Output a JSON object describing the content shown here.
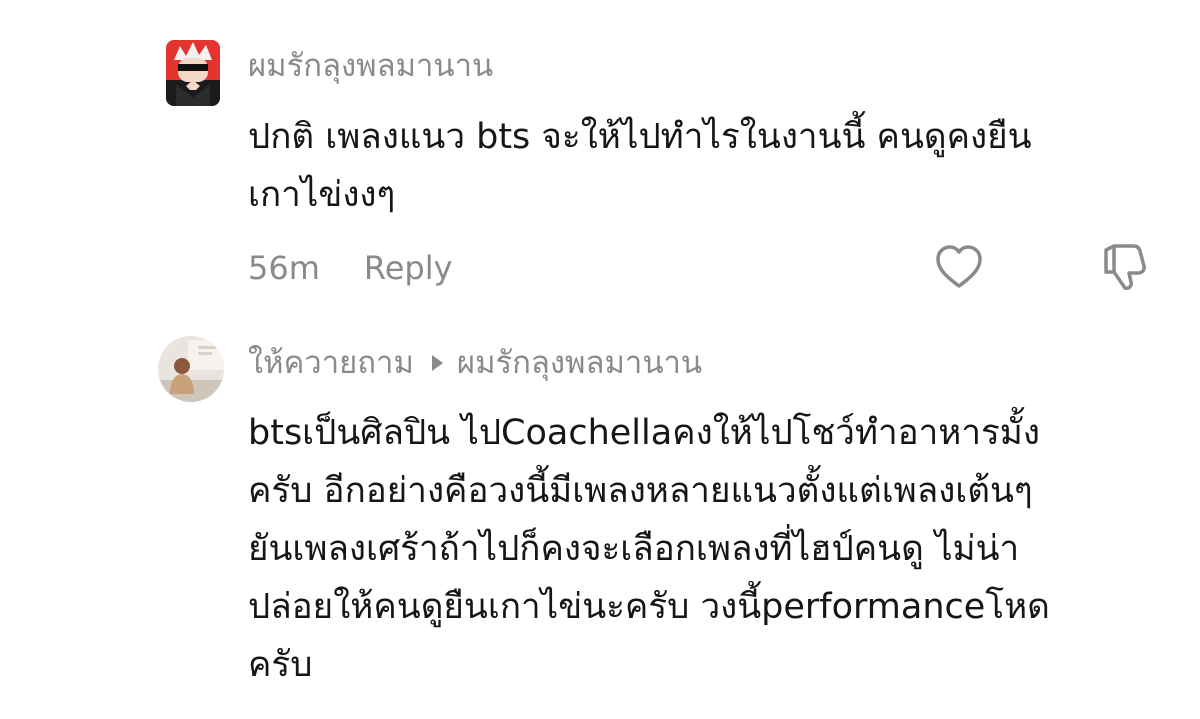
{
  "comments": [
    {
      "username": "ผมรักลุงพลมานาน",
      "avatar_icon": "anime-character-avatar",
      "lines": [
        "ปกติ เพลงแนว bts จะให้ไปทำไรในงานนี้ คนดูคงยืน",
        "เกาไข่งงๆ"
      ],
      "time": "56m",
      "reply_label": "Reply",
      "like_icon": "heart-outline-icon",
      "dislike_icon": "thumbs-down-outline-icon"
    },
    {
      "username": "ให้ควายถาม",
      "reply_to": "ผมรักลุงพลมานาน",
      "avatar_icon": "photo-avatar",
      "lines": [
        "btsเป็นศิลปิน ไปCoachellaคงให้ไปโชว์ทำอาหารมั้ง",
        "ครับ อีกอย่างคือวงนี้มีเพลงหลายแนวตั้งแต่เพลงเต้นๆ",
        "ยันเพลงเศร้าถ้าไปก็คงจะเลือกเพลงที่ไฮป์คนดู ไม่น่า",
        "ปล่อยให้คนดูยืนเกาไข่นะครับ วงนี้performanceโหด",
        "ครับ"
      ]
    }
  ],
  "colors": {
    "text_primary": "#161616",
    "text_secondary": "#8a8a8a",
    "avatar_accent": "#e3342f"
  }
}
